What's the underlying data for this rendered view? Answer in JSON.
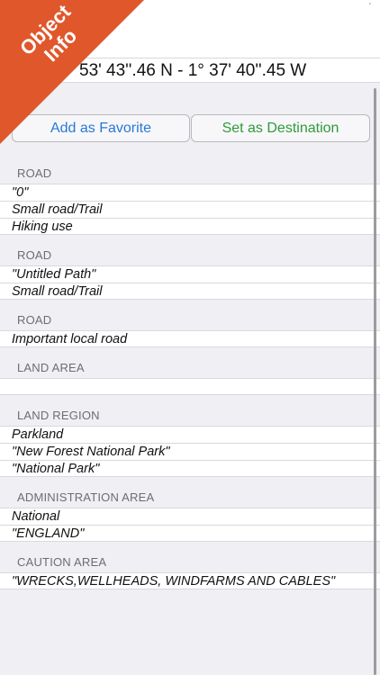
{
  "banner": {
    "line1": "Object",
    "line2": "Info",
    "color": "#e0572b"
  },
  "coordinates": "53' 43''.46 N  -  1° 37' 40''.45 W",
  "top_mark": "'",
  "buttons": {
    "favorite": "Add as Favorite",
    "destination": "Set as Destination"
  },
  "sections": [
    {
      "title": "ROAD",
      "items": [
        "\"0\"",
        "Small road/Trail",
        "Hiking use"
      ]
    },
    {
      "title": "ROAD",
      "items": [
        "\"Untitled Path\"",
        "Small road/Trail"
      ]
    },
    {
      "title": "ROAD",
      "items": [
        "Important local road"
      ]
    },
    {
      "title": "LAND AREA",
      "items": [
        ""
      ]
    },
    {
      "title": "LAND REGION",
      "items": [
        "Parkland",
        "\"New Forest National Park\"",
        "\"National Park\""
      ]
    },
    {
      "title": "ADMINISTRATION AREA",
      "items": [
        "National",
        "\"ENGLAND\""
      ]
    },
    {
      "title": "CAUTION AREA",
      "items": [
        "\"WRECKS,WELLHEADS, WINDFARMS AND CABLES\""
      ]
    }
  ],
  "colors": {
    "favorite": "#2a78d6",
    "destination": "#2f9b3a"
  }
}
